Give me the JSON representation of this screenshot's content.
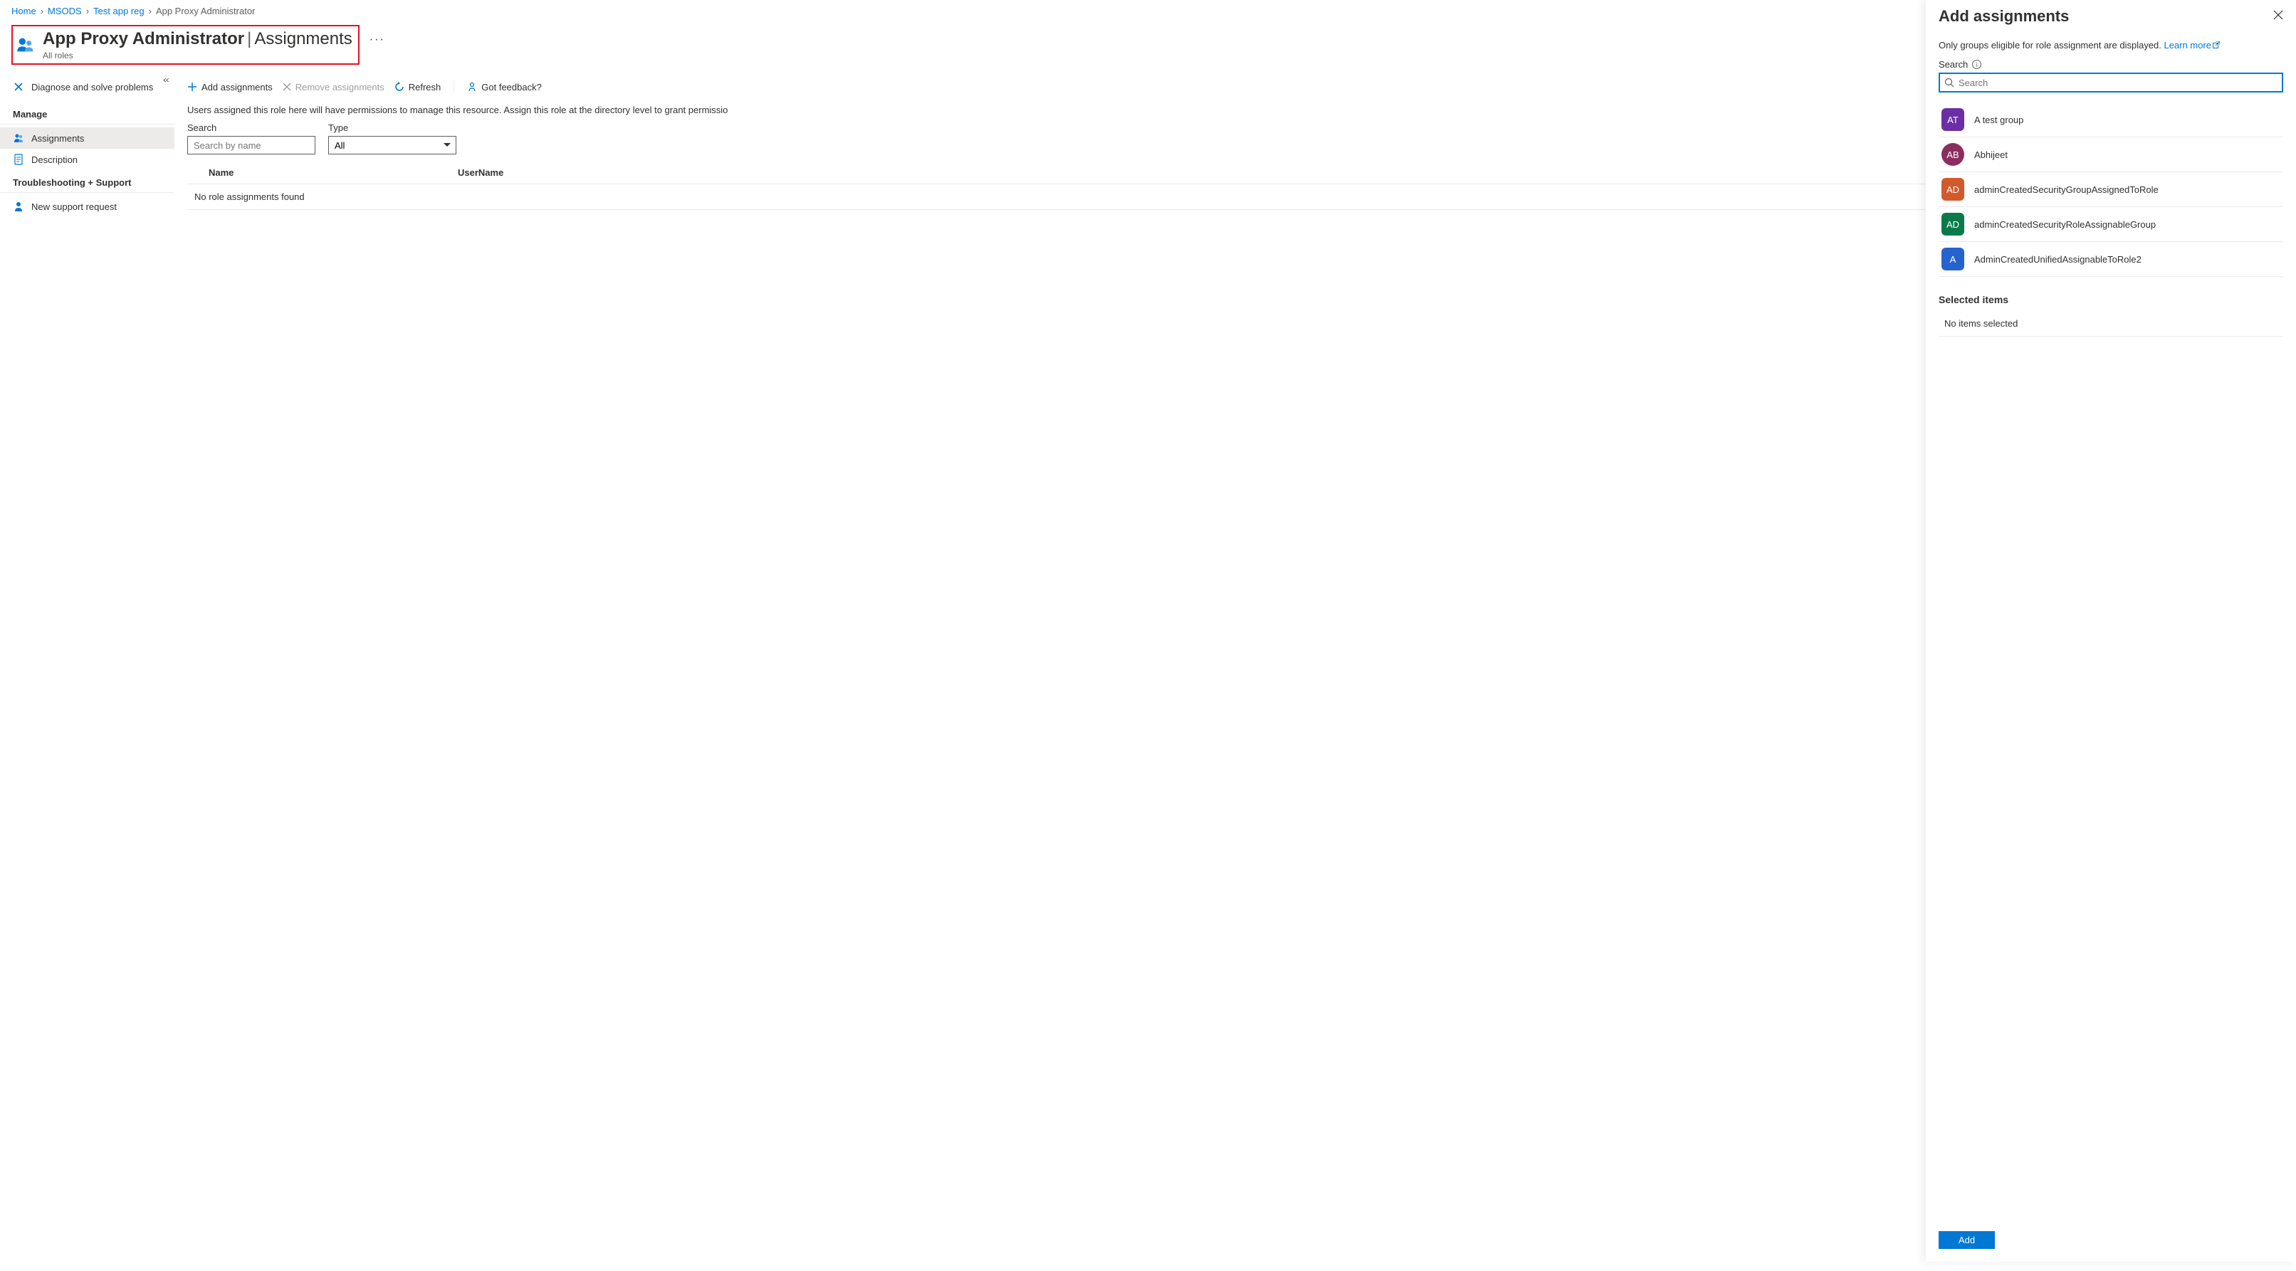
{
  "breadcrumb": {
    "items": [
      {
        "label": "Home"
      },
      {
        "label": "MSODS"
      },
      {
        "label": "Test app reg"
      },
      {
        "label": "App Proxy Administrator"
      }
    ]
  },
  "header": {
    "title": "App Proxy Administrator",
    "section": "Assignments",
    "subtitle": "All roles"
  },
  "sidebar": {
    "diagnose": "Diagnose and solve problems",
    "heading_manage": "Manage",
    "assignments": "Assignments",
    "description": "Description",
    "heading_troubleshoot": "Troubleshooting + Support",
    "support": "New support request"
  },
  "toolbar": {
    "add": "Add assignments",
    "remove": "Remove assignments",
    "refresh": "Refresh",
    "feedback": "Got feedback?"
  },
  "content": {
    "description": "Users assigned this role here will have permissions to manage this resource. Assign this role at the directory level to grant permissio",
    "search_label": "Search",
    "search_placeholder": "Search by name",
    "type_label": "Type",
    "type_value": "All",
    "col_name": "Name",
    "col_username": "UserName",
    "empty": "No role assignments found"
  },
  "flyout": {
    "title": "Add assignments",
    "info_text": "Only groups eligible for role assignment are displayed. ",
    "learn_more": "Learn more",
    "search_label": "Search",
    "search_placeholder": "Search",
    "results": [
      {
        "initials": "AT",
        "name": "A test group",
        "bg": "#6b2fa5",
        "shape": "square"
      },
      {
        "initials": "AB",
        "name": "Abhijeet",
        "bg": "#8a2e5f",
        "shape": "circle"
      },
      {
        "initials": "AD",
        "name": "adminCreatedSecurityGroupAssignedToRole",
        "bg": "#d15a2c",
        "shape": "square"
      },
      {
        "initials": "AD",
        "name": "adminCreatedSecurityRoleAssignableGroup",
        "bg": "#0b7a4b",
        "shape": "square"
      },
      {
        "initials": "A",
        "name": "AdminCreatedUnifiedAssignableToRole2",
        "bg": "#2564cf",
        "shape": "square"
      }
    ],
    "selected_heading": "Selected items",
    "no_selected": "No items selected",
    "add_button": "Add"
  }
}
